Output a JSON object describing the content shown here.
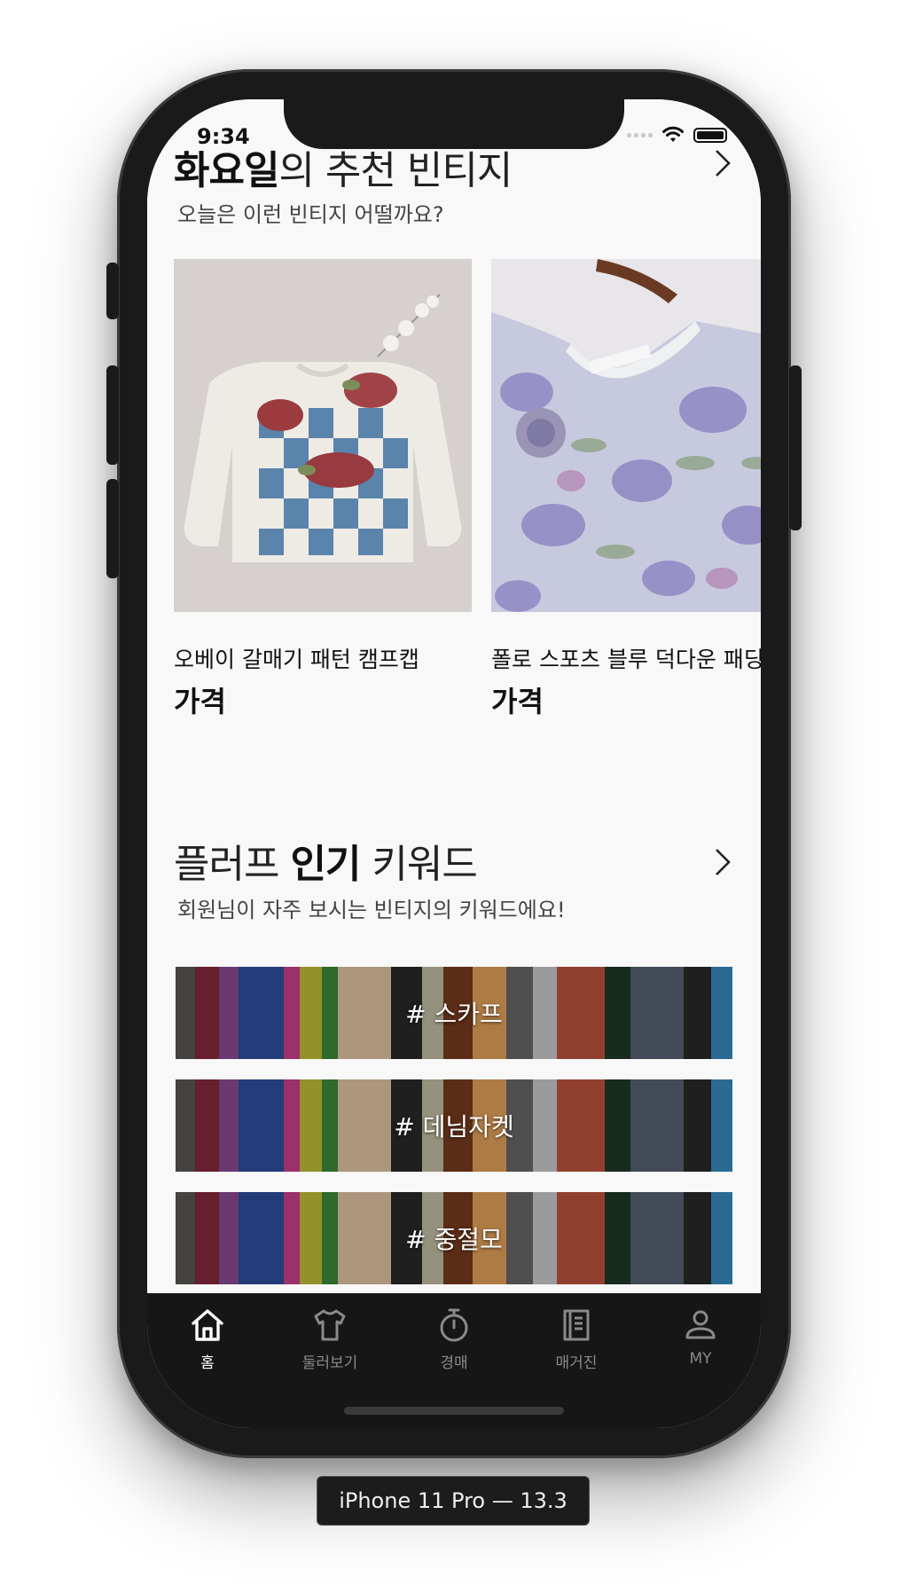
{
  "status_bar": {
    "time": "9:34"
  },
  "recommend": {
    "title_bold": "화요일",
    "title_rest": "의 추천 빈티지",
    "subtitle": "오늘은 이런 빈티지 어떨까요?",
    "items": [
      {
        "name": "오베이 갈매기 패턴 캠프캡",
        "price_label": "가격",
        "image": "white and blue checkered knit sweater with red floral embroidery"
      },
      {
        "name": "폴로 스포츠 블루 덕다운 패딩",
        "price_label": "가격",
        "image": "purple and blue floral print blouse on a hanger"
      }
    ]
  },
  "keywords": {
    "title_pre": "플러프 ",
    "title_bold": "인기",
    "title_post": " 키워드",
    "subtitle": "회원님이 자주 보시는 빈티지의 키워드에요!",
    "items": [
      {
        "label": "# 스카프"
      },
      {
        "label": "# 데님자켓"
      },
      {
        "label": "# 중절모"
      }
    ]
  },
  "tabbar": {
    "tabs": [
      {
        "label": "홈",
        "icon": "home-icon",
        "active": true
      },
      {
        "label": "둘러보기",
        "icon": "tshirt-icon",
        "active": false
      },
      {
        "label": "경매",
        "icon": "stopwatch-icon",
        "active": false
      },
      {
        "label": "매거진",
        "icon": "book-icon",
        "active": false
      },
      {
        "label": "MY",
        "icon": "person-icon",
        "active": false
      }
    ]
  },
  "device_label": "iPhone 11 Pro — 13.3",
  "colors": {
    "tab_active": "#ffffff",
    "tab_inactive": "#8a8a8a",
    "tabbar_bg": "#161616",
    "screen_bg": "#f8f8f8"
  }
}
